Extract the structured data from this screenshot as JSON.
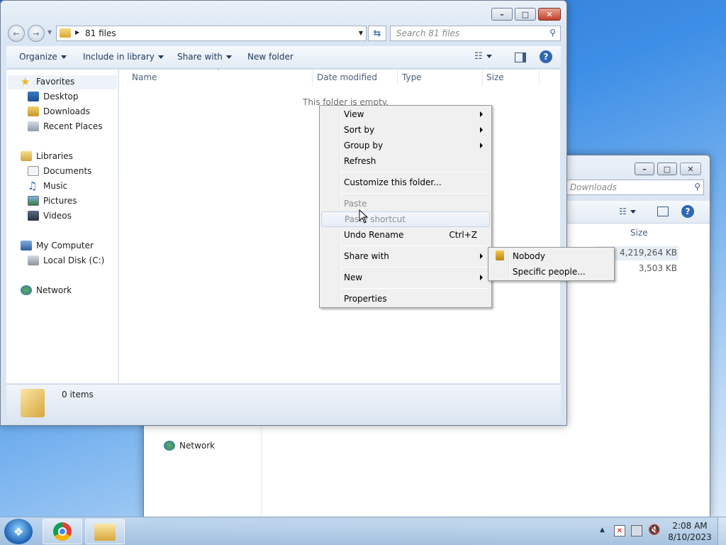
{
  "front_window": {
    "breadcrumb": "81 files",
    "search_placeholder": "Search 81 files",
    "toolbar": {
      "organize": "Organize",
      "include_in_library": "Include in library",
      "share_with": "Share with",
      "new_folder": "New folder"
    },
    "nav": {
      "favorites": "Favorites",
      "desktop": "Desktop",
      "downloads": "Downloads",
      "recent_places": "Recent Places",
      "libraries": "Libraries",
      "documents": "Documents",
      "music": "Music",
      "pictures": "Pictures",
      "videos": "Videos",
      "my_computer": "My Computer",
      "local_disk": "Local Disk (C:)",
      "network": "Network"
    },
    "columns": [
      "Name",
      "Date modified",
      "Type",
      "Size"
    ],
    "empty_message": "This folder is empty.",
    "status": "0 items"
  },
  "back_window": {
    "search_placeholder": "Downloads",
    "size_header": "Size",
    "sizes": [
      "4,219,264 KB",
      "3,503 KB"
    ],
    "network": "Network"
  },
  "context_menu": {
    "view": "View",
    "sort_by": "Sort by",
    "group_by": "Group by",
    "refresh": "Refresh",
    "customize": "Customize this folder...",
    "paste": "Paste",
    "paste_shortcut": "Paste shortcut",
    "undo_rename": "Undo Rename",
    "undo_shortcut": "Ctrl+Z",
    "share_with": "Share with",
    "new": "New",
    "properties": "Properties"
  },
  "submenu": {
    "nobody": "Nobody",
    "specific_people": "Specific people..."
  },
  "taskbar": {
    "time": "2:08 AM",
    "date": "8/10/2023"
  }
}
